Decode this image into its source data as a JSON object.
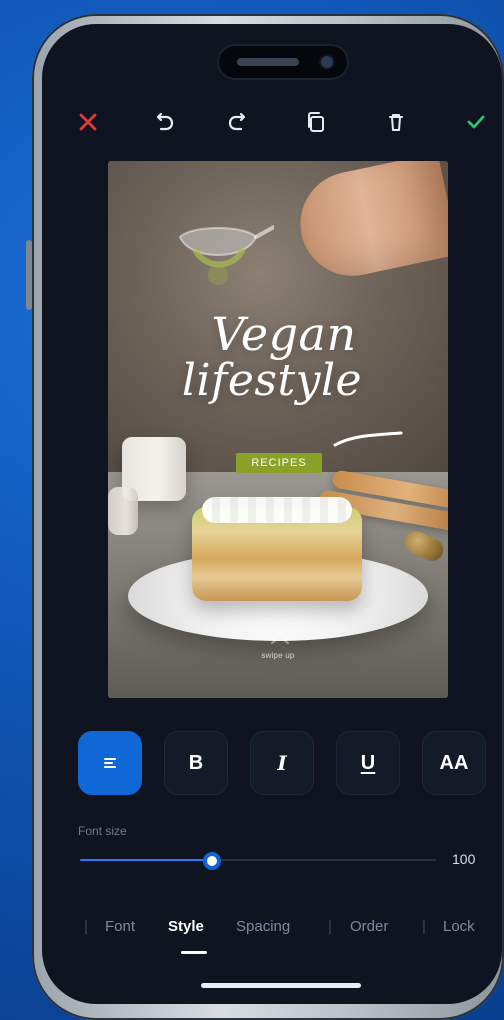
{
  "colors": {
    "background_blue": "#0f57b8",
    "screen_bg": "#0f1420",
    "accent_blue": "#1067d6",
    "close_red": "#e23a3a",
    "confirm_green": "#2fc26b",
    "badge_green": "#8aa22a"
  },
  "toolbar": {
    "close_icon": "close-icon",
    "undo_icon": "undo-icon",
    "redo_icon": "redo-icon",
    "duplicate_icon": "copy-icon",
    "delete_icon": "trash-icon",
    "confirm_icon": "check-icon"
  },
  "poster": {
    "title_line1": "Vegan",
    "title_line2": "lifestyle",
    "badge": "RECIPES",
    "footer": "swipe up"
  },
  "style_controls": {
    "align": "≡",
    "bold": "B",
    "italic": "I",
    "underline": "U",
    "case": "AA"
  },
  "font_size": {
    "label": "Font size",
    "value": "100",
    "fraction": 0.37
  },
  "bottom_tabs": {
    "items": [
      "Font",
      "Style",
      "Spacing",
      "Order",
      "Lock"
    ],
    "active": "Style"
  }
}
